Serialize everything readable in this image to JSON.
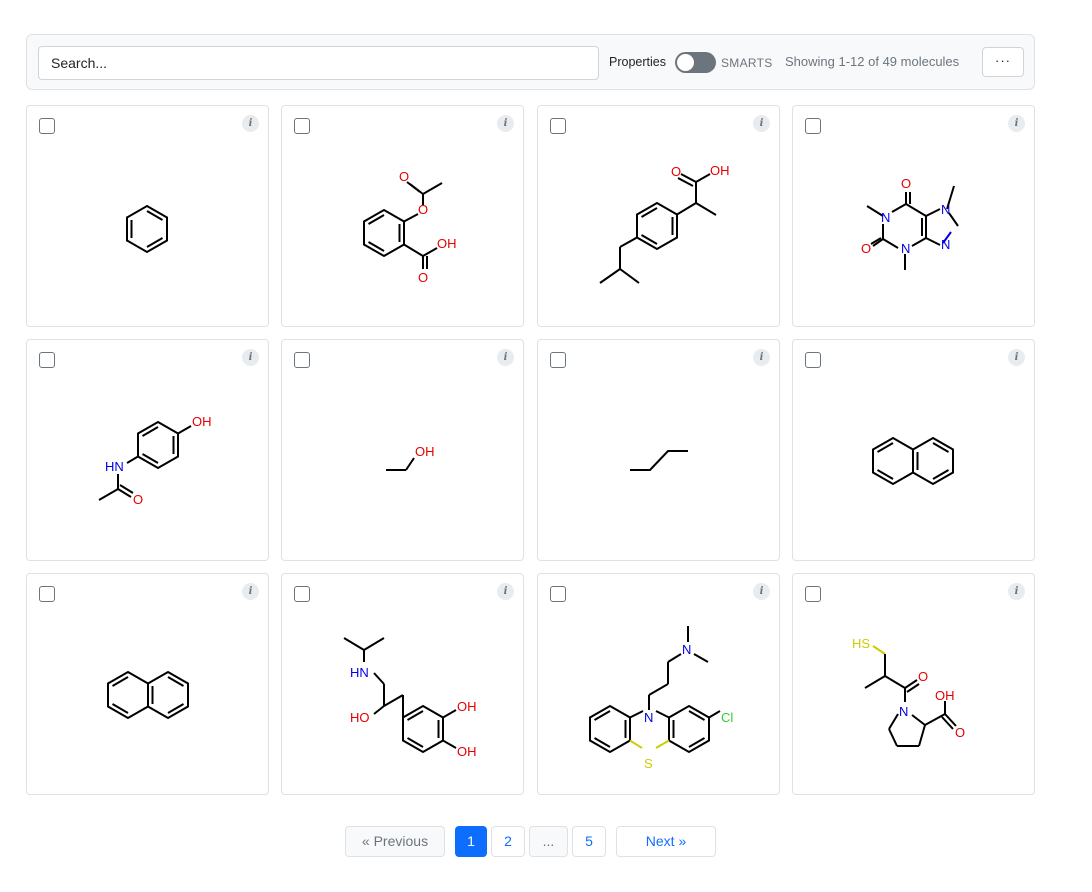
{
  "toolbar": {
    "search_placeholder": "Search...",
    "properties_label": "Properties",
    "smarts_label": "SMARTS",
    "count_text": "Showing 1-12 of 49 molecules",
    "more_label": "···"
  },
  "cards": [
    {
      "name": "benzene",
      "info": "i",
      "atom_labels": []
    },
    {
      "name": "aspirin",
      "info": "i",
      "atom_labels": [
        "O",
        "O",
        "OH",
        "O"
      ]
    },
    {
      "name": "ibuprofen",
      "info": "i",
      "atom_labels": [
        "O",
        "OH"
      ]
    },
    {
      "name": "caffeine",
      "info": "i",
      "atom_labels": [
        "O",
        "N",
        "N",
        "O",
        "N",
        "N"
      ]
    },
    {
      "name": "paracetamol",
      "info": "i",
      "atom_labels": [
        "OH",
        "HN",
        "O"
      ]
    },
    {
      "name": "ethanol",
      "info": "i",
      "atom_labels": [
        "OH"
      ]
    },
    {
      "name": "butane",
      "info": "i",
      "atom_labels": []
    },
    {
      "name": "naphthalene",
      "info": "i",
      "atom_labels": []
    },
    {
      "name": "naphthalene-2",
      "info": "i",
      "atom_labels": []
    },
    {
      "name": "isoproterenol",
      "info": "i",
      "atom_labels": [
        "HN",
        "HO",
        "OH",
        "OH"
      ]
    },
    {
      "name": "chlorpromazine",
      "info": "i",
      "atom_labels": [
        "N",
        "N",
        "Cl",
        "S"
      ]
    },
    {
      "name": "captopril",
      "info": "i",
      "atom_labels": [
        "HS",
        "O",
        "N",
        "OH",
        "O"
      ]
    }
  ],
  "pagination": {
    "previous": "« Previous",
    "pages": [
      "1",
      "2",
      "...",
      "5"
    ],
    "active_page": "1",
    "next": "Next »"
  },
  "colors": {
    "bond": "#000000",
    "oxygen": "#e60000",
    "nitrogen": "#0000e6",
    "sulfur": "#cccc00",
    "chlorine": "#33cc33",
    "accent": "#0d6efd"
  }
}
